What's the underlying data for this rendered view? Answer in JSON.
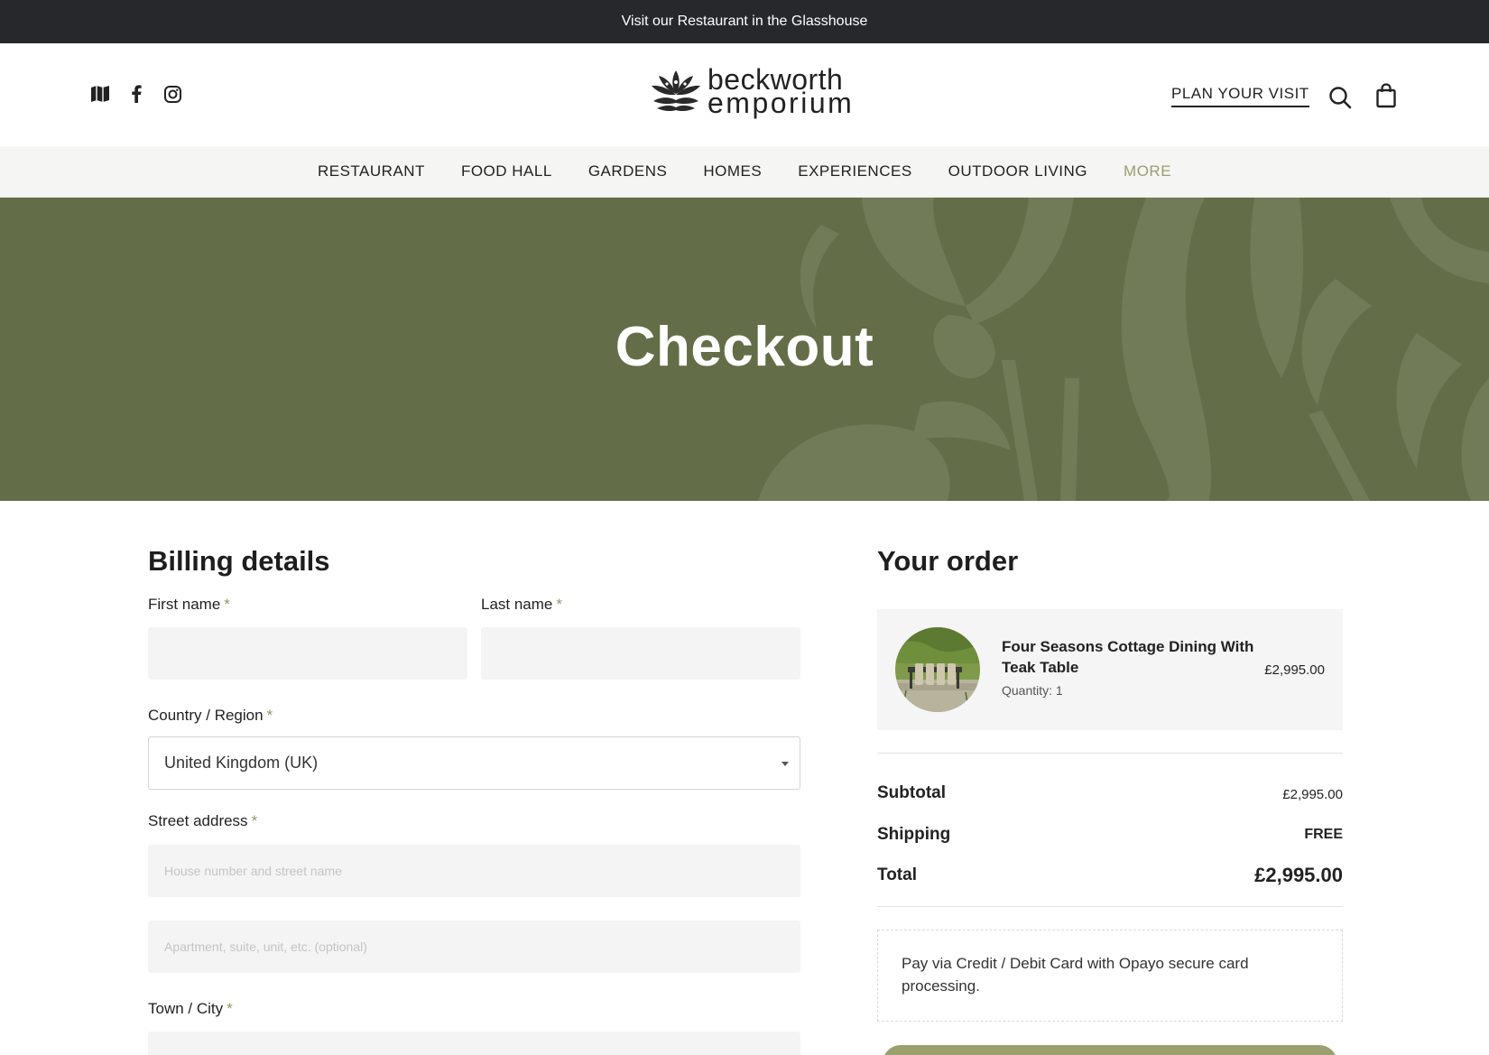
{
  "topbar": {
    "message": "Visit our Restaurant in the Glasshouse"
  },
  "header": {
    "social_icons": [
      "map-icon",
      "facebook-icon",
      "instagram-icon"
    ],
    "logo": {
      "line1": "beckworth",
      "line2": "emporium"
    },
    "plan_visit_label": "PLAN YOUR VISIT",
    "icons": [
      "search-icon",
      "shopping-bag-icon"
    ]
  },
  "nav": {
    "items": [
      {
        "label": "RESTAURANT"
      },
      {
        "label": "FOOD HALL"
      },
      {
        "label": "GARDENS"
      },
      {
        "label": "HOMES"
      },
      {
        "label": "EXPERIENCES"
      },
      {
        "label": "OUTDOOR LIVING"
      },
      {
        "label": "MORE"
      }
    ]
  },
  "hero": {
    "title": "Checkout"
  },
  "billing": {
    "title": "Billing details",
    "first_name": {
      "label": "First name",
      "required": "*",
      "value": ""
    },
    "last_name": {
      "label": "Last name",
      "required": "*",
      "value": ""
    },
    "country": {
      "label": "Country / Region",
      "required": "*",
      "selected": "United Kingdom (UK)"
    },
    "street": {
      "label": "Street address",
      "required": "*",
      "placeholder1": "House number and street name",
      "placeholder2": "Apartment, suite, unit, etc. (optional)"
    },
    "town": {
      "label": "Town / City",
      "required": "*",
      "value": ""
    }
  },
  "order": {
    "title": "Your order",
    "item": {
      "name": "Four Seasons Cottage Dining With Teak Table",
      "quantity": "Quantity: 1",
      "price": "£2,995.00"
    },
    "subtotal_label": "Subtotal",
    "subtotal_value": "£2,995.00",
    "shipping_label": "Shipping",
    "shipping_value": "FREE",
    "total_label": "Total",
    "total_value": "£2,995.00",
    "payment_text": "Pay via Credit / Debit Card with Opayo secure card processing."
  },
  "colors": {
    "topbar": "#26282b",
    "hero": "#636d47",
    "accent": "#8e9a5f",
    "more_link": "#9a9d6f",
    "button": "#9ca06f"
  }
}
